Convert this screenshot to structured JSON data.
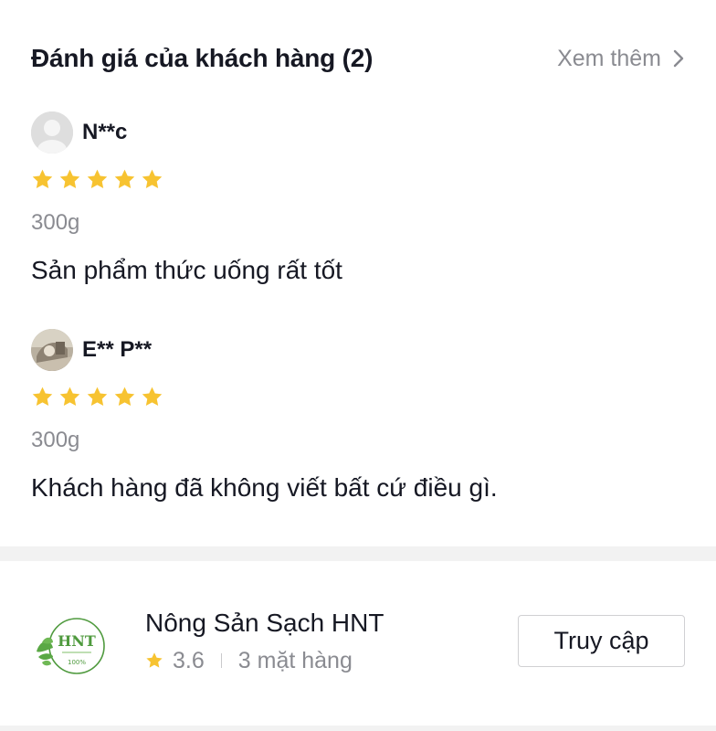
{
  "reviews_section": {
    "title": "Đánh giá của khách hàng (2)",
    "see_more_label": "Xem thêm",
    "star_color": "#f7c331",
    "reviews": [
      {
        "name": "N**c",
        "rating": 5,
        "variant": "300g",
        "text": "Sản phẩm thức uống rất tốt",
        "avatar": "default-person-icon"
      },
      {
        "name": "E** P**",
        "rating": 5,
        "variant": "300g",
        "text": "Khách hàng đã không viết bất cứ điều gì.",
        "avatar": "user-photo"
      }
    ]
  },
  "shop": {
    "logo_text": "HNT",
    "logo_percent": "100%",
    "name": "Nông Sản Sạch HNT",
    "rating": "3.6",
    "items_count": "3 mặt hàng",
    "visit_label": "Truy cập",
    "brand_color": "#4f9a3e"
  }
}
